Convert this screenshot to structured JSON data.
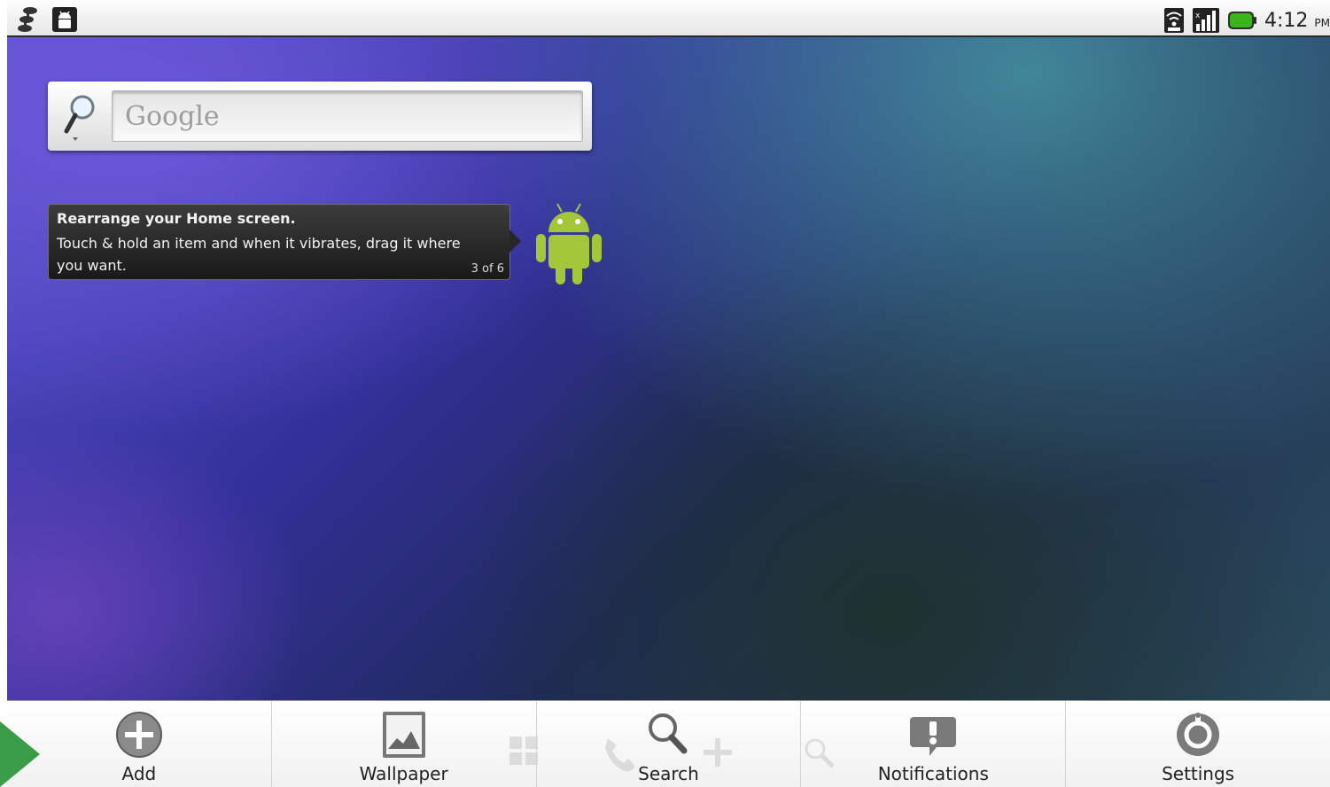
{
  "status_bar": {
    "time": "4:12",
    "ampm": "PM",
    "left_icons": [
      "usb-debug-icon",
      "android-notification-icon"
    ],
    "right_icons": [
      "wifi-icon",
      "signal-icon",
      "battery-icon"
    ]
  },
  "search_widget": {
    "placeholder": "Google"
  },
  "tip": {
    "title": "Rearrange your Home screen.",
    "body": "Touch & hold an item and when it vibrates, drag it where you want.",
    "counter": "3 of 6"
  },
  "menu": {
    "items": [
      {
        "label": "Add",
        "icon": "add-icon"
      },
      {
        "label": "Wallpaper",
        "icon": "wallpaper-icon"
      },
      {
        "label": "Search",
        "icon": "search-icon"
      },
      {
        "label": "Notifications",
        "icon": "notifications-icon"
      },
      {
        "label": "Settings",
        "icon": "settings-icon"
      }
    ]
  },
  "colors": {
    "battery": "#3cb41e",
    "android_green": "#a4c639",
    "corner_arrow": "#3a9c47"
  }
}
